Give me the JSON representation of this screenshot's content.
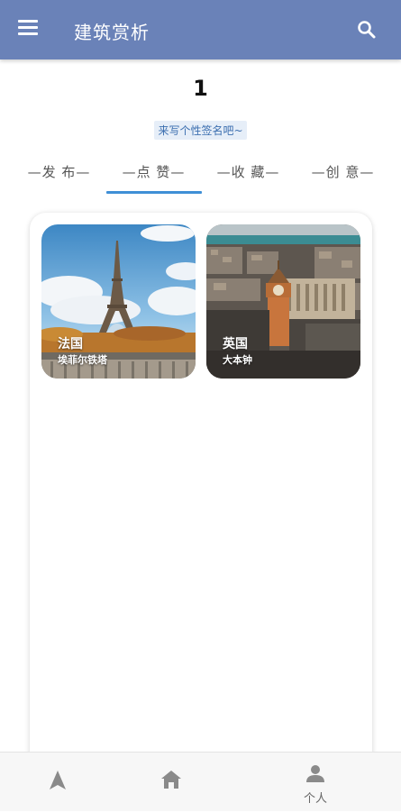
{
  "header": {
    "title": "建筑赏析",
    "menu_icon": "hamburger-menu-icon",
    "search_icon": "search-icon",
    "background": "#6a82b8"
  },
  "profile": {
    "count": "1",
    "signature": "来写个性签名吧~"
  },
  "tabs": [
    {
      "label": "—发 布—"
    },
    {
      "label": "—点 赞—",
      "active": true
    },
    {
      "label": "—收 藏—"
    },
    {
      "label": "—创 意—"
    }
  ],
  "cards": [
    {
      "country": "法国",
      "name": "埃菲尔铁塔"
    },
    {
      "country": "英国",
      "name": "大本钟"
    }
  ],
  "bottom_nav": [
    {
      "icon": "navigation-arrow-icon",
      "label": ""
    },
    {
      "icon": "home-icon",
      "label": ""
    },
    {
      "icon": "person-icon",
      "label": "个人"
    }
  ],
  "accent_color": "#3f8fd6"
}
